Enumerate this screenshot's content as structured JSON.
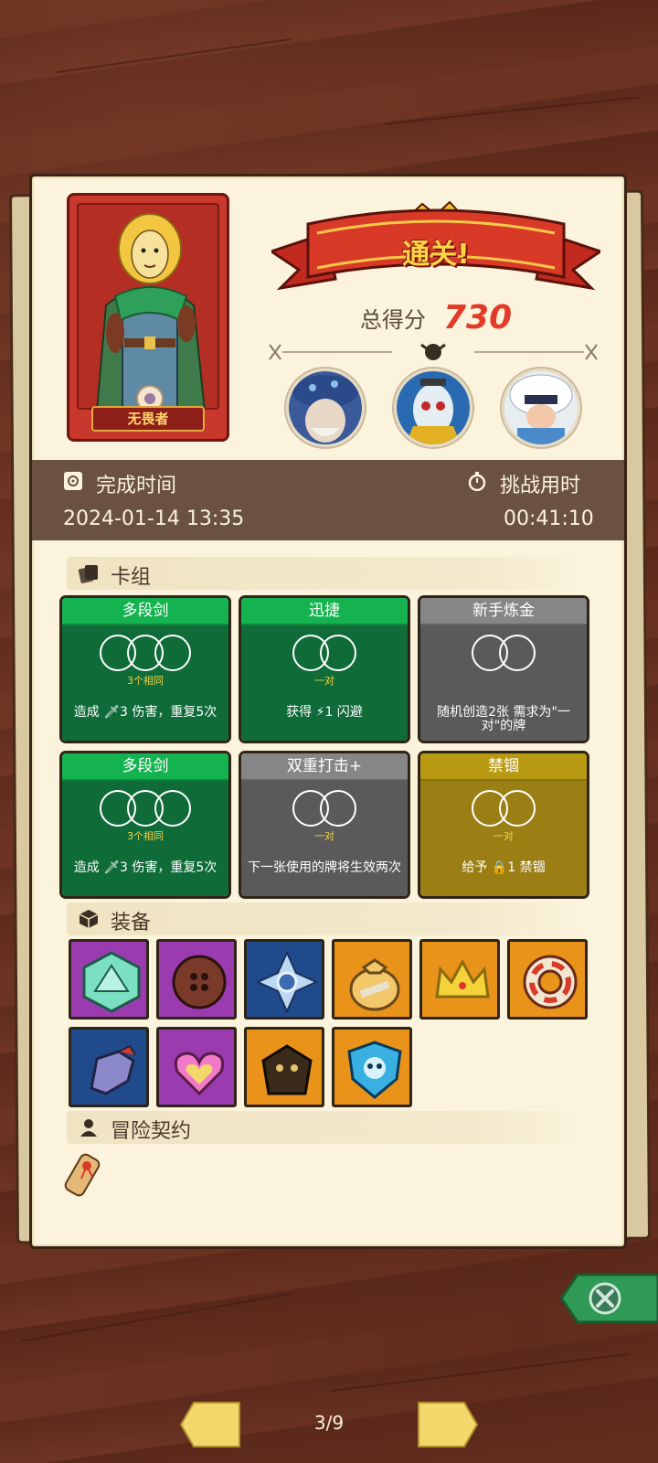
{
  "hero": {
    "name": "无畏者"
  },
  "banner": {
    "title": "通关!"
  },
  "score": {
    "label": "总得分",
    "value": "730"
  },
  "bosses": [
    {
      "name": "mushroom-boss-portrait"
    },
    {
      "name": "masked-boss-portrait"
    },
    {
      "name": "furry-boss-portrait"
    }
  ],
  "stats": {
    "finish_label": "完成时间",
    "finish_value": "2024-01-14 13:35",
    "time_label": "挑战用时",
    "time_value": "00:41:10"
  },
  "deck": {
    "title": "卡组",
    "cards": [
      {
        "title": "多段剑",
        "color": "green",
        "rings": 3,
        "sub": "3个相同",
        "desc": "造成 🗡3 伤害，重复5次"
      },
      {
        "title": "迅捷",
        "color": "green",
        "rings": 2,
        "sub": "一对",
        "desc": "获得 ⚡1 闪避"
      },
      {
        "title": "新手炼金",
        "color": "gray",
        "rings": 2,
        "sub": "",
        "desc": "随机创造2张 需求为\"一对\"的牌"
      },
      {
        "title": "多段剑",
        "color": "green",
        "rings": 3,
        "sub": "3个相同",
        "desc": "造成 🗡3 伤害，重复5次"
      },
      {
        "title": "双重打击+",
        "color": "gray",
        "rings": 2,
        "sub": "一对",
        "desc": "下一张使用的牌将生效两次"
      },
      {
        "title": "禁锢",
        "color": "gold",
        "rings": 2,
        "sub": "一对",
        "desc": "给予 🔒1 禁锢"
      }
    ]
  },
  "equipment": {
    "title": "装备",
    "items": [
      {
        "name": "d20-dice-icon",
        "color": "purple"
      },
      {
        "name": "button-icon",
        "color": "purple"
      },
      {
        "name": "snowflake-emblem-icon",
        "color": "blue"
      },
      {
        "name": "money-bag-icon",
        "color": "orange"
      },
      {
        "name": "crown-icon",
        "color": "orange"
      },
      {
        "name": "life-ring-icon",
        "color": "orange"
      },
      {
        "name": "gauntlet-icon",
        "color": "blue"
      },
      {
        "name": "heart-amulet-icon",
        "color": "purple"
      },
      {
        "name": "dark-cloak-icon",
        "color": "orange"
      },
      {
        "name": "skull-shield-icon",
        "color": "orange"
      }
    ]
  },
  "contract": {
    "title": "冒险契约",
    "items": [
      {
        "name": "scroll-icon"
      }
    ]
  },
  "pager": {
    "current": "3/9"
  },
  "colors": {
    "accent_red": "#e23b2a",
    "banner_gold": "#ffd447",
    "close_green": "#2f9a55"
  }
}
